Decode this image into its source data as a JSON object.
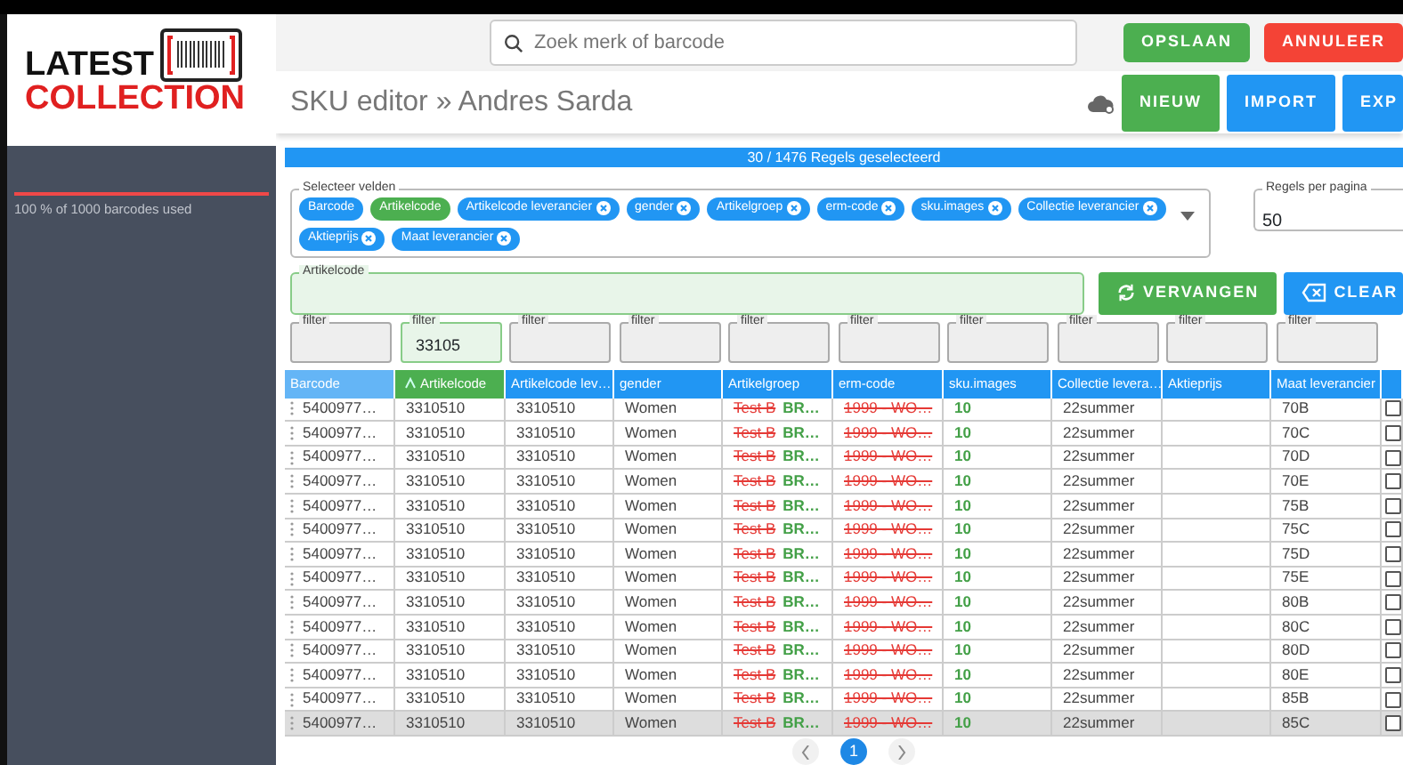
{
  "logo": {
    "line1": "LATEST",
    "line2": "COLLECTION"
  },
  "sidebar": {
    "usage": {
      "level": 1.0,
      "text": "100 % of 1000 barcodes used"
    }
  },
  "topbar": {
    "search": {
      "placeholder": "Zoek merk of barcode"
    },
    "buttons": [
      {
        "label": "OPSLAAN",
        "kind": "success"
      },
      {
        "label": "ANNULEER",
        "kind": "danger"
      }
    ]
  },
  "header": {
    "breadcrumb": [
      "SKU editor",
      "Andres Sarda"
    ],
    "separator": "»",
    "buttons": [
      {
        "label": "NIEUW",
        "kind": "success"
      },
      {
        "label": "IMPORT",
        "kind": "primary"
      },
      {
        "label": "EXP",
        "kind": "primary"
      }
    ]
  },
  "selection_bar": {
    "text": "30 / 1476 Regels geselecteerd"
  },
  "field_select": {
    "label": "Selecteer velden",
    "chips": [
      {
        "label": "Barcode",
        "removable": false,
        "selected": false
      },
      {
        "label": "Artikelcode",
        "removable": false,
        "selected": true
      },
      {
        "label": "Artikelcode leverancier",
        "removable": true,
        "selected": false
      },
      {
        "label": "gender",
        "removable": true,
        "selected": false
      },
      {
        "label": "Artikelgroep",
        "removable": true,
        "selected": false
      },
      {
        "label": "erm-code",
        "removable": true,
        "selected": false
      },
      {
        "label": "sku.images",
        "removable": true,
        "selected": false
      },
      {
        "label": "Collectie leverancier",
        "removable": true,
        "selected": false
      },
      {
        "label": "Aktieprijs",
        "removable": true,
        "selected": false
      },
      {
        "label": "Maat leverancier",
        "removable": true,
        "selected": false
      }
    ]
  },
  "rows_per_page": {
    "label": "Regels per pagina",
    "value": "50"
  },
  "replace": {
    "label": "Artikelcode",
    "buttons": [
      {
        "label": "VERVANGEN",
        "kind": "success"
      },
      {
        "label": "CLEAR",
        "kind": "primary"
      }
    ]
  },
  "filters": [
    {
      "label": "filter",
      "active": false
    },
    {
      "label": "filter",
      "value": "33105",
      "active": true
    },
    {
      "label": "filter",
      "active": false
    },
    {
      "label": "filter",
      "active": false
    },
    {
      "label": "filter",
      "active": false
    },
    {
      "label": "filter",
      "active": false
    },
    {
      "label": "filter",
      "active": false
    },
    {
      "label": "filter",
      "active": false
    },
    {
      "label": "filter",
      "active": false
    },
    {
      "label": "filter",
      "active": false
    }
  ],
  "table": {
    "columns": [
      {
        "label": "Barcode",
        "kind": "hover"
      },
      {
        "label": "Artikelcode",
        "kind": "sorted"
      },
      {
        "label": "Artikelcode lev…",
        "kind": "plain"
      },
      {
        "label": "gender",
        "kind": "plain"
      },
      {
        "label": "Artikelgroep",
        "kind": "plain"
      },
      {
        "label": "erm-code",
        "kind": "plain"
      },
      {
        "label": "sku.images",
        "kind": "plain"
      },
      {
        "label": "Collectie levera…",
        "kind": "plain"
      },
      {
        "label": "Aktieprijs",
        "kind": "plain"
      },
      {
        "label": "Maat leverancier",
        "kind": "plain"
      }
    ],
    "rows": [
      {
        "barcode": "5400977…",
        "artikelcode": "3310510",
        "artikelcode_lev": "3310510",
        "gender": "Women",
        "artikelgroep_old": "Test B",
        "artikelgroep_new": "BR…",
        "erm_code_old": "1999 - WO…",
        "images": "10",
        "collectie": "22summer",
        "maat": "70B",
        "checked": false,
        "highlighted": false
      },
      {
        "barcode": "5400977…",
        "artikelcode": "3310510",
        "artikelcode_lev": "3310510",
        "gender": "Women",
        "artikelgroep_old": "Test B",
        "artikelgroep_new": "BR…",
        "erm_code_old": "1999 - WO…",
        "images": "10",
        "collectie": "22summer",
        "maat": "70C",
        "checked": false,
        "highlighted": false
      },
      {
        "barcode": "5400977…",
        "artikelcode": "3310510",
        "artikelcode_lev": "3310510",
        "gender": "Women",
        "artikelgroep_old": "Test B",
        "artikelgroep_new": "BR…",
        "erm_code_old": "1999 - WO…",
        "images": "10",
        "collectie": "22summer",
        "maat": "70D",
        "checked": false,
        "highlighted": false
      },
      {
        "barcode": "5400977…",
        "artikelcode": "3310510",
        "artikelcode_lev": "3310510",
        "gender": "Women",
        "artikelgroep_old": "Test B",
        "artikelgroep_new": "BR…",
        "erm_code_old": "1999 - WO…",
        "images": "10",
        "collectie": "22summer",
        "maat": "70E",
        "checked": false,
        "highlighted": false
      },
      {
        "barcode": "5400977…",
        "artikelcode": "3310510",
        "artikelcode_lev": "3310510",
        "gender": "Women",
        "artikelgroep_old": "Test B",
        "artikelgroep_new": "BR…",
        "erm_code_old": "1999 - WO…",
        "images": "10",
        "collectie": "22summer",
        "maat": "75B",
        "checked": false,
        "highlighted": false
      },
      {
        "barcode": "5400977…",
        "artikelcode": "3310510",
        "artikelcode_lev": "3310510",
        "gender": "Women",
        "artikelgroep_old": "Test B",
        "artikelgroep_new": "BR…",
        "erm_code_old": "1999 - WO…",
        "images": "10",
        "collectie": "22summer",
        "maat": "75C",
        "checked": false,
        "highlighted": false
      },
      {
        "barcode": "5400977…",
        "artikelcode": "3310510",
        "artikelcode_lev": "3310510",
        "gender": "Women",
        "artikelgroep_old": "Test B",
        "artikelgroep_new": "BR…",
        "erm_code_old": "1999 - WO…",
        "images": "10",
        "collectie": "22summer",
        "maat": "75D",
        "checked": false,
        "highlighted": false
      },
      {
        "barcode": "5400977…",
        "artikelcode": "3310510",
        "artikelcode_lev": "3310510",
        "gender": "Women",
        "artikelgroep_old": "Test B",
        "artikelgroep_new": "BR…",
        "erm_code_old": "1999 - WO…",
        "images": "10",
        "collectie": "22summer",
        "maat": "75E",
        "checked": false,
        "highlighted": false
      },
      {
        "barcode": "5400977…",
        "artikelcode": "3310510",
        "artikelcode_lev": "3310510",
        "gender": "Women",
        "artikelgroep_old": "Test B",
        "artikelgroep_new": "BR…",
        "erm_code_old": "1999 - WO…",
        "images": "10",
        "collectie": "22summer",
        "maat": "80B",
        "checked": false,
        "highlighted": false
      },
      {
        "barcode": "5400977…",
        "artikelcode": "3310510",
        "artikelcode_lev": "3310510",
        "gender": "Women",
        "artikelgroep_old": "Test B",
        "artikelgroep_new": "BR…",
        "erm_code_old": "1999 - WO…",
        "images": "10",
        "collectie": "22summer",
        "maat": "80C",
        "checked": false,
        "highlighted": false
      },
      {
        "barcode": "5400977…",
        "artikelcode": "3310510",
        "artikelcode_lev": "3310510",
        "gender": "Women",
        "artikelgroep_old": "Test B",
        "artikelgroep_new": "BR…",
        "erm_code_old": "1999 - WO…",
        "images": "10",
        "collectie": "22summer",
        "maat": "80D",
        "checked": false,
        "highlighted": false
      },
      {
        "barcode": "5400977…",
        "artikelcode": "3310510",
        "artikelcode_lev": "3310510",
        "gender": "Women",
        "artikelgroep_old": "Test B",
        "artikelgroep_new": "BR…",
        "erm_code_old": "1999 - WO…",
        "images": "10",
        "collectie": "22summer",
        "maat": "80E",
        "checked": false,
        "highlighted": false
      },
      {
        "barcode": "5400977…",
        "artikelcode": "3310510",
        "artikelcode_lev": "3310510",
        "gender": "Women",
        "artikelgroep_old": "Test B",
        "artikelgroep_new": "BR…",
        "erm_code_old": "1999 - WO…",
        "images": "10",
        "collectie": "22summer",
        "maat": "85B",
        "checked": false,
        "highlighted": false
      },
      {
        "barcode": "5400977…",
        "artikelcode": "3310510",
        "artikelcode_lev": "3310510",
        "gender": "Women",
        "artikelgroep_old": "Test B",
        "artikelgroep_new": "BR…",
        "erm_code_old": "1999 - WO…",
        "images": "10",
        "collectie": "22summer",
        "maat": "85C",
        "checked": false,
        "highlighted": true
      }
    ]
  },
  "pagination": {
    "pages": [
      {
        "label": "1",
        "selected": true
      }
    ]
  }
}
